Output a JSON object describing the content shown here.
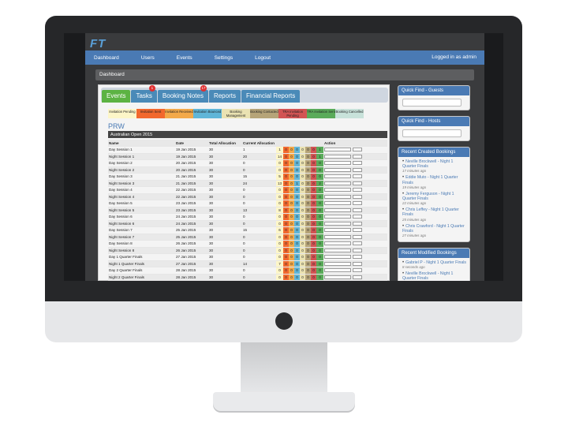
{
  "app": {
    "logo_a": "F",
    "logo_b": "T"
  },
  "nav": {
    "items": [
      "Dashboard",
      "Users",
      "Events",
      "Settings",
      "Logout"
    ],
    "login": "Logged in as admin"
  },
  "breadcrumb": "Dashboard",
  "tabs": [
    {
      "label": "Events",
      "badge": ""
    },
    {
      "label": "Tasks",
      "badge": "1"
    },
    {
      "label": "Booking Notes",
      "badge": "17"
    },
    {
      "label": "Reports",
      "badge": ""
    },
    {
      "label": "Financial Reports",
      "badge": ""
    }
  ],
  "legend": [
    "Invitation Pending",
    "Invitation Sent",
    "Invitation Received",
    "Invitation Bounced",
    "Booking Management",
    "Booking Contacted",
    "TRA Invitation Pending",
    "TRA Invitation Sent",
    "Booking Cancelled"
  ],
  "page_heading": "PRW",
  "event_title": "Australian Open 2015",
  "table": {
    "headers": [
      "Name",
      "Date",
      "Total Allocation",
      "Current Allocation",
      "Action"
    ],
    "rows": [
      [
        "Day Session 1",
        "19 Jan 2015",
        "30",
        "1",
        "1",
        "0",
        "0",
        "0",
        "0",
        "0",
        "0",
        "1"
      ],
      [
        "Night Session 1",
        "19 Jan 2015",
        "30",
        "20",
        "14",
        "0",
        "0",
        "0",
        "0",
        "0",
        "0",
        "1"
      ],
      [
        "Day Session 2",
        "20 Jan 2015",
        "30",
        "0",
        "0",
        "0",
        "0",
        "0",
        "0",
        "0",
        "0",
        "0"
      ],
      [
        "Night Session 2",
        "20 Jan 2015",
        "30",
        "0",
        "0",
        "0",
        "0",
        "0",
        "0",
        "0",
        "0",
        "0"
      ],
      [
        "Day Session 3",
        "21 Jan 2015",
        "30",
        "15",
        "5",
        "0",
        "0",
        "0",
        "0",
        "0",
        "0",
        "0"
      ],
      [
        "Night Session 3",
        "21 Jan 2015",
        "30",
        "24",
        "13",
        "0",
        "0",
        "1",
        "0",
        "0",
        "0",
        "2"
      ],
      [
        "Day Session 4",
        "22 Jan 2015",
        "30",
        "0",
        "0",
        "0",
        "0",
        "0",
        "0",
        "0",
        "0",
        "0"
      ],
      [
        "Night Session 4",
        "22 Jan 2015",
        "30",
        "0",
        "0",
        "0",
        "0",
        "0",
        "0",
        "0",
        "0",
        "0"
      ],
      [
        "Day Session 5",
        "23 Jan 2015",
        "30",
        "0",
        "0",
        "0",
        "0",
        "0",
        "0",
        "0",
        "0",
        "0"
      ],
      [
        "Night Session 5",
        "23 Jan 2015",
        "30",
        "13",
        "8",
        "0",
        "0",
        "0",
        "0",
        "0",
        "0",
        "0"
      ],
      [
        "Day Session 6",
        "24 Jan 2015",
        "30",
        "0",
        "0",
        "0",
        "0",
        "0",
        "0",
        "0",
        "0",
        "0"
      ],
      [
        "Night Session 6",
        "24 Jan 2015",
        "30",
        "0",
        "0",
        "0",
        "0",
        "0",
        "0",
        "0",
        "0",
        "0"
      ],
      [
        "Day Session 7",
        "25 Jan 2015",
        "30",
        "15",
        "6",
        "0",
        "0",
        "0",
        "0",
        "0",
        "0",
        "0"
      ],
      [
        "Night Session 7",
        "25 Jan 2015",
        "30",
        "0",
        "0",
        "0",
        "0",
        "0",
        "0",
        "0",
        "0",
        "0"
      ],
      [
        "Day Session 8",
        "26 Jan 2015",
        "30",
        "0",
        "0",
        "0",
        "0",
        "0",
        "0",
        "0",
        "0",
        "0"
      ],
      [
        "Night Session 8",
        "26 Jan 2015",
        "30",
        "0",
        "0",
        "0",
        "0",
        "0",
        "0",
        "0",
        "0",
        "0"
      ],
      [
        "Day 1 Quarter Finals",
        "27 Jan 2015",
        "30",
        "0",
        "0",
        "0",
        "0",
        "0",
        "0",
        "0",
        "0",
        "0"
      ],
      [
        "Night 1 Quarter Finals",
        "27 Jan 2015",
        "30",
        "14",
        "7",
        "0",
        "0",
        "0",
        "0",
        "0",
        "0",
        "0"
      ],
      [
        "Day 2 Quarter Finals",
        "28 Jan 2015",
        "30",
        "0",
        "0",
        "0",
        "0",
        "0",
        "0",
        "0",
        "0",
        "0"
      ],
      [
        "Night 2 Quarter Finals",
        "28 Jan 2015",
        "30",
        "0",
        "0",
        "0",
        "0",
        "0",
        "0",
        "0",
        "0",
        "0"
      ]
    ]
  },
  "sidebar": {
    "guests_title": "Quick Find - Guests",
    "hosts_title": "Quick Find - Hosts",
    "created_title": "Recent Created Bookings",
    "created": [
      {
        "text": "Neville Brockwell - Night 1 Quarter Finals",
        "time": "17 minutes ago"
      },
      {
        "text": "Eddie Muto - Night 1 Quarter Finals",
        "time": "19 minutes ago"
      },
      {
        "text": "Jeremy Ferguson - Night 1 Quarter Finals",
        "time": "22 minutes ago"
      },
      {
        "text": "Chris Leffey - Night 1 Quarter Finals",
        "time": "25 minutes ago"
      },
      {
        "text": "Chris Crawford - Night 1 Quarter Finals",
        "time": "27 minutes ago"
      }
    ],
    "modified_title": "Recent Modified Bookings",
    "modified": [
      {
        "text": "Gabriel P - Night 1 Quarter Finals",
        "time": "8 seconds ago"
      },
      {
        "text": "Neville Brockwell - Night 1 Quarter Finals",
        "time": ""
      }
    ]
  }
}
